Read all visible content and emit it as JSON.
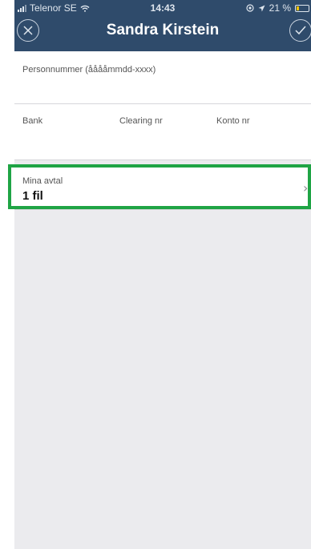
{
  "status_bar": {
    "carrier": "Telenor SE",
    "time": "14:43",
    "battery_percent": "21 %",
    "battery_level": 0.21,
    "icons": [
      "signal-icon",
      "wifi-icon",
      "location-lock-icon",
      "location-arrow-icon",
      "battery-icon"
    ]
  },
  "nav": {
    "title": "Sandra Kirstein",
    "left_icon": "close-icon",
    "right_icon": "checkmark-icon"
  },
  "form": {
    "personnummer_label": "Personnummer (ååååmmdd-xxxx)",
    "bank_label": "Bank",
    "clearing_label": "Clearing nr",
    "konto_label": "Konto nr"
  },
  "contracts": {
    "label": "Mina avtal",
    "value": "1 fil",
    "chevron_icon": "chevron-right-icon"
  },
  "colors": {
    "header": "#2f4b6b",
    "background": "#ebebee",
    "highlight": "#1fa445",
    "battery": "#f2c200"
  }
}
